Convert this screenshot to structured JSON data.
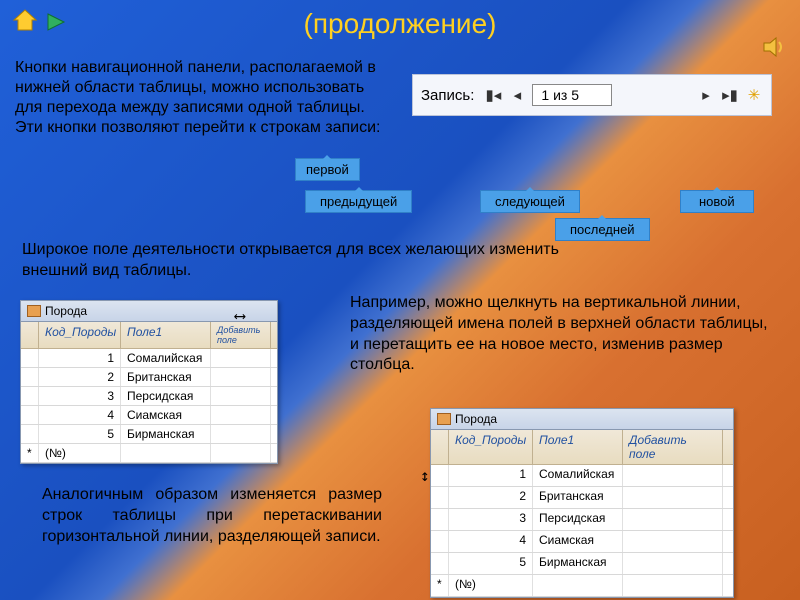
{
  "title": "(продолжение)",
  "para1": "Кнопки навигационной панели, располагаемой в нижней области таблицы, можно использовать для перехода между записями одной таблицы. Эти кнопки позволяют перейти к строкам записи:",
  "para2": "Широкое поле деятельности открывается для всех желающих изменить внешний вид таблицы.",
  "para3": "Например, можно щелкнуть на вертикальной линии, разделяющей имена полей в верхней области таблицы, и перетащить ее на новое место, изменив размер столбца.",
  "para4": "Аналогичным образом изменяется размер строк таблицы при перетаскивании горизонтальной линии, разделяющей записи.",
  "nav": {
    "label": "Запись:",
    "current": "1 из 5"
  },
  "tags": {
    "first": "первой",
    "prev": "предыдущей",
    "next": "следующей",
    "last": "последней",
    "new": "новой"
  },
  "table": {
    "title": "Порода",
    "cols": [
      "Код_Породы",
      "Поле1",
      "Добавить поле"
    ],
    "newph": "(№)",
    "rows": [
      {
        "id": "1",
        "name": "Сомалийская"
      },
      {
        "id": "2",
        "name": "Британская"
      },
      {
        "id": "3",
        "name": "Персидская"
      },
      {
        "id": "4",
        "name": "Сиамская"
      },
      {
        "id": "5",
        "name": "Бирманская"
      }
    ]
  }
}
